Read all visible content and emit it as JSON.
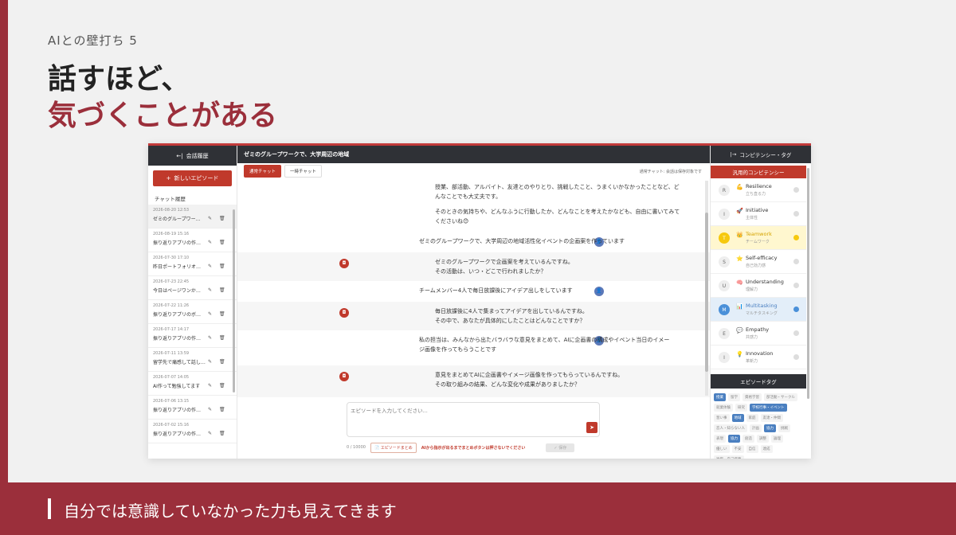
{
  "slide": {
    "kicker": "AIとの壁打ち 5",
    "title_line1": "話すほど、",
    "title_line2": "気づくことがある",
    "caption": "自分では意識していなかった力も見えてきます"
  },
  "sidebar": {
    "header": "会話履歴",
    "header_icon": "←|",
    "new_button": "新しいエピソード",
    "new_icon": "+",
    "history_label": "チャット履歴",
    "edit_icon": "✎",
    "delete_icon": "🗑",
    "items": [
      {
        "date": "2026-08-20 12:53",
        "title": "ゼミのグループワー…"
      },
      {
        "date": "2026-08-19 15:16",
        "title": "振り返りアプリの作…"
      },
      {
        "date": "2026-07-30 17:10",
        "title": "昨日ポートフォリオ…"
      },
      {
        "date": "2026-07-23 22:45",
        "title": "今日はページワンか…"
      },
      {
        "date": "2026-07-22 11:26",
        "title": "振り返りアプリのボ…"
      },
      {
        "date": "2026-07-17 14:17",
        "title": "振り返りアプリの作…"
      },
      {
        "date": "2026-07-11 13:59",
        "title": "留学先で痛感して話し…"
      },
      {
        "date": "2026-07-07 14:05",
        "title": "AI作って勉強してます"
      },
      {
        "date": "2026-07-06 13:15",
        "title": "振り返りアプリの作…"
      },
      {
        "date": "2026-07-02 15:16",
        "title": "振り返りアプリの作…"
      }
    ]
  },
  "main": {
    "header": "ゼミのグループワークで、大学周辺の地域",
    "tab_normal": "通常チャット",
    "tab_temp": "一時チャット",
    "tabs_note": "通常チャット: 会話は保存対象です",
    "ai_icon": "◘",
    "user_icon": "👤",
    "messages": [
      {
        "role": "ai",
        "lines": [
          "授業、部活動、アルバイト、友達とのやりとり、挑戦したこと、うまくいかなかったことなど、ど",
          "んなことでも大丈夫です。"
        ],
        "icon": false
      },
      {
        "role": "ai",
        "lines": [
          "そのときの気持ちや、どんなふうに行動したか、どんなことを考えたかなども、自由に書いてみて",
          "くださいね😊"
        ],
        "icon": false
      },
      {
        "role": "user",
        "lines": [
          "ゼミのグループワークで、大学周辺の地域活性化イベントの企画案を作っています"
        ]
      },
      {
        "role": "ai",
        "lines": [
          "ゼミのグループワークで企画案を考えているんですね。",
          "その活動は、いつ・どこで行われましたか？"
        ],
        "icon": true
      },
      {
        "role": "user",
        "lines": [
          "チームメンバー4人で毎日放課後にアイデア出しをしています"
        ]
      },
      {
        "role": "ai",
        "lines": [
          "毎日放課後に4人で集まってアイデアを出しているんですね。",
          "その中で、あなたが具体的にしたことはどんなことですか？"
        ],
        "icon": true
      },
      {
        "role": "user",
        "lines": [
          "私の担当は、みんなから出たバラバラな意見をまとめて、AIに企画書の構成やイベント当日のイメー",
          "ジ画像を作ってもらうことです"
        ]
      },
      {
        "role": "ai",
        "lines": [
          "意見をまとめてAIに企画書やイメージ画像を作ってもらっているんですね。",
          "その取り組みの結果、どんな変化や成果がありましたか？"
        ],
        "icon": true
      }
    ],
    "input_placeholder": "エピソードを入力してください...",
    "send_icon": "➤",
    "counter": "0 / 10000",
    "summary_button": "エピソードまとめ",
    "summary_icon": "📄",
    "warning": "AIから指示が出るまでまとめボタンは押さないでください",
    "save_button": "保存",
    "save_icon": "✓"
  },
  "rpanel": {
    "header": "コンピテンシー・タグ",
    "header_icon": "|→",
    "section_title": "汎用的コンピテンシー",
    "competencies": [
      {
        "letter": "R",
        "icon": "💪",
        "name": "Resilience",
        "sub": "立ち直る力",
        "hl": ""
      },
      {
        "letter": "I",
        "icon": "🚀",
        "name": "Initiative",
        "sub": "主体性",
        "hl": ""
      },
      {
        "letter": "T",
        "icon": "👑",
        "name": "Teamwork",
        "sub": "チームワーク",
        "hl": "yellow"
      },
      {
        "letter": "S",
        "icon": "⭐",
        "name": "Self-efficacy",
        "sub": "自己効力感",
        "hl": ""
      },
      {
        "letter": "U",
        "icon": "🧠",
        "name": "Understanding",
        "sub": "理解力",
        "hl": ""
      },
      {
        "letter": "M",
        "icon": "📊",
        "name": "Multitasking",
        "sub": "マルチタスキング",
        "hl": "blue"
      },
      {
        "letter": "E",
        "icon": "💬",
        "name": "Empathy",
        "sub": "共感力",
        "hl": ""
      },
      {
        "letter": "I",
        "icon": "💡",
        "name": "Innovation",
        "sub": "革新力",
        "hl": ""
      }
    ],
    "tags_title": "エピソードタグ",
    "tags": [
      {
        "label": "授業",
        "on": true
      },
      {
        "label": "留学",
        "on": false
      },
      {
        "label": "資格学習",
        "on": false
      },
      {
        "label": "部活動・サークル",
        "on": false
      },
      {
        "label": "就業体験",
        "on": false
      },
      {
        "label": "研究",
        "on": false
      },
      {
        "label": "学校行事・イベント",
        "on": true
      },
      {
        "label": "習い事",
        "on": false
      },
      {
        "label": "地域",
        "on": true
      },
      {
        "label": "家庭",
        "on": false
      },
      {
        "label": "友達・仲間",
        "on": false
      },
      {
        "label": "恋人・知らない人",
        "on": false
      },
      {
        "label": "計画",
        "on": false
      },
      {
        "label": "協力",
        "on": true
      },
      {
        "label": "挑戦",
        "on": false
      },
      {
        "label": "表現",
        "on": false
      },
      {
        "label": "協力",
        "on": true
      },
      {
        "label": "創造",
        "on": false
      },
      {
        "label": "調整",
        "on": false
      },
      {
        "label": "論理",
        "on": false
      },
      {
        "label": "優しい",
        "on": false
      },
      {
        "label": "不安",
        "on": false
      },
      {
        "label": "自信",
        "on": false
      },
      {
        "label": "達成",
        "on": false
      },
      {
        "label": "後悔・自己嫌悪",
        "on": false
      }
    ]
  }
}
